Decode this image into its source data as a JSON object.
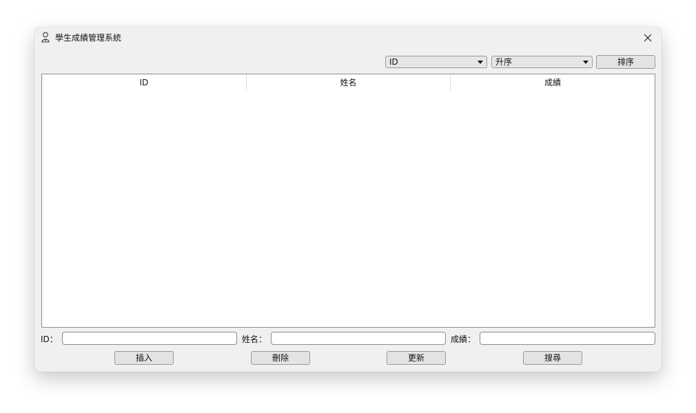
{
  "window": {
    "title": "學生成績管理系統",
    "app_icon": "student-icon",
    "close_icon": "close-icon"
  },
  "toolbar": {
    "sort_field_value": "ID",
    "sort_order_value": "升序",
    "sort_button_label": "排序"
  },
  "table": {
    "columns": [
      "ID",
      "姓名",
      "成績"
    ],
    "rows": []
  },
  "form": {
    "id_label": "ID：",
    "name_label": "姓名：",
    "score_label": "成績：",
    "id_value": "",
    "name_value": "",
    "score_value": ""
  },
  "actions": {
    "insert_label": "插入",
    "delete_label": "刪除",
    "update_label": "更新",
    "search_label": "搜尋"
  }
}
